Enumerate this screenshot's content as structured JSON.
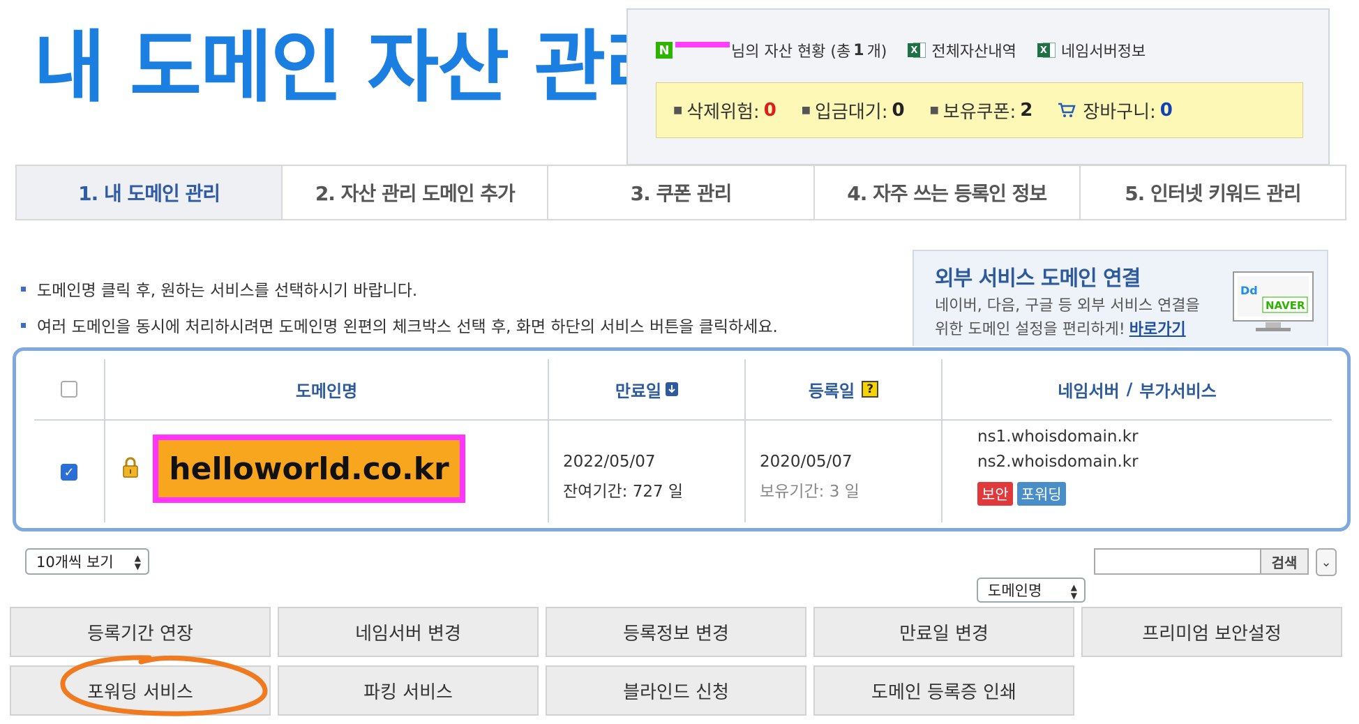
{
  "title": "내 도메인 자산 관리",
  "summary": {
    "owner_suffix": "님의 자산 현황 (총 ",
    "count": "1",
    "count_unit": " 개)",
    "full_assets_label": "전체자산내역",
    "nameserver_info_label": "네임서버정보",
    "status": [
      {
        "label": "삭제위험:",
        "value": "0",
        "color": "#e01b1b"
      },
      {
        "label": "입금대기:",
        "value": "0",
        "color": "#222222"
      },
      {
        "label": "보유쿠폰:",
        "value": "2",
        "color": "#222222"
      },
      {
        "label": "장바구니:",
        "value": "0",
        "color": "#1042b7",
        "icon": "cart-icon"
      }
    ]
  },
  "tabs": [
    {
      "label": "1. 내 도메인 관리",
      "active": true
    },
    {
      "label": "2. 자산 관리 도메인 추가",
      "active": false
    },
    {
      "label": "3. 쿠폰 관리",
      "active": false
    },
    {
      "label": "4. 자주 쓰는 등록인 정보",
      "active": false
    },
    {
      "label": "5. 인터넷 키워드 관리",
      "active": false
    }
  ],
  "notes": [
    "도메인명 클릭 후, 원하는 서비스를 선택하시기 바랍니다.",
    "여러 도메인을 동시에 처리하시려면 도메인명 왼편의 체크박스 선택 후, 화면 하단의 서비스 버튼을 클릭하세요."
  ],
  "external": {
    "title": "외부 서비스 도메인 연결",
    "desc_line1": "네이버, 다음, 구글 등 외부 서비스 연결을",
    "desc_line2": "위한 도메인 설정을 편리하게!",
    "link": "바로가기",
    "monitor_logo": "NAVER",
    "monitor_mini": "Dd"
  },
  "table": {
    "headers": {
      "domain": "도메인명",
      "expiry": "만료일",
      "registered": "등록일",
      "ns": "네임서버",
      "ns_sep": "/",
      "addon": "부가서비스"
    },
    "rows": [
      {
        "checked": true,
        "domain": "helloworld.co.kr",
        "expiry": "2022/05/07",
        "remaining": "잔여기간: 727 일",
        "registered": "2020/05/07",
        "held": "보유기간: 3 일",
        "ns1": "ns1.whoisdomain.kr",
        "ns2": "ns2.whoisdomain.kr",
        "tags": [
          {
            "label": "보안",
            "color": "#e0393c"
          },
          {
            "label": "포워딩",
            "color": "#4a8ec8"
          }
        ]
      }
    ]
  },
  "controls": {
    "page_size": "10개씩 보기",
    "search_field": "도메인명",
    "search_value": "",
    "search_button": "검색"
  },
  "actions": [
    "등록기간 연장",
    "네임서버 변경",
    "등록정보 변경",
    "만료일 변경",
    "프리미엄 보안설정",
    "포워딩 서비스",
    "파킹 서비스",
    "블라인드 신청",
    "도메인 등록증 인쇄"
  ]
}
